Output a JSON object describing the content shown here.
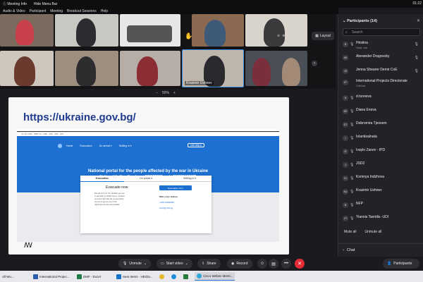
{
  "meeting": {
    "info_label": "Meeting Info",
    "hide_menu_label": "Hide Menu Bar",
    "clock": "01:22"
  },
  "menu": [
    "Audio & Video",
    "Participant",
    "Meeting",
    "Breakout Sessions",
    "Help"
  ],
  "videos": {
    "active_speaker_name": "Krasimir Ushnev",
    "layout_label": "Layout"
  },
  "zoom": {
    "value": "55%",
    "minus": "−",
    "plus": "+"
  },
  "share": {
    "url": "https://ukraine.gov.bg/",
    "site": {
      "topline": "☏ 02 / 905 · 5555   ☏ +380 · 322 · 465 · 075",
      "nav": [
        "Home",
        "Evacuation",
        "On arrival ▾",
        "Settling in ▾"
      ],
      "help_label": "Get help ▸",
      "headline": "National portal for the people affected by the war in Ukraine",
      "hotline": "National Hotline Numbers: 029055555 and +380322465075",
      "tabs": [
        "Evacuation",
        "On arrival ▾",
        "Settling in ▾"
      ],
      "card_title": "Evacuate now",
      "card_para": "We are sorry for the situation you are in and wish to shelter from it. Contact us at the right side tell us everything we can to get you out of the nightmare as soon as possible!",
      "evac_button": "Evacuation form",
      "mfa_label": "MFA crisis hotline:",
      "phone": "+359 29048080",
      "email": "crisis@mfa.bg"
    },
    "footer_mark": "ꟿ"
  },
  "toolbar": {
    "unmute_label": "Unmute",
    "video_label": "Start video",
    "share_label": "Share",
    "record_label": "Record",
    "more_label": "•••",
    "participants_label": "Participants"
  },
  "participants": {
    "title": "Participants (14)",
    "search_placeholder": "Search",
    "list": [
      {
        "name": "Hristina",
        "sub": "Host, me",
        "initials": "H"
      },
      {
        "name": "Alexander Dragovsky",
        "sub": "",
        "initials": "AD"
      },
      {
        "name": "Jenna Shearer Demir CoE",
        "sub": "",
        "initials": "JS"
      },
      {
        "name": "International Projects Directorate",
        "sub": "Cohost",
        "initials": "IP"
      },
      {
        "name": "d.tsoneva",
        "sub": "",
        "initials": "D"
      },
      {
        "name": "Diana Eneva",
        "sub": "",
        "initials": "DE"
      },
      {
        "name": "Dobromira Tjessem",
        "sub": "",
        "initials": "DT"
      },
      {
        "name": "Iolantioalnata",
        "sub": "",
        "initials": "I"
      },
      {
        "name": "Ivaylo Zanev - IPD",
        "sub": "",
        "initials": "IZ"
      },
      {
        "name": "JSD2",
        "sub": "",
        "initials": "J"
      },
      {
        "name": "Komnya Indzhova",
        "sub": "",
        "initials": "KI"
      },
      {
        "name": "Krasimir Ushnev",
        "sub": "",
        "initials": "KU"
      },
      {
        "name": "NFP",
        "sub": "",
        "initials": "N"
      },
      {
        "name": "Yiannis Tavridis -UDI",
        "sub": "",
        "initials": "YT"
      }
    ],
    "mute_all": "Mute all",
    "unmute_all": "Unmute all",
    "chat_label": "Chat"
  },
  "taskbar": [
    {
      "label": "oft Wo..."
    },
    {
      "label": "International Projec..."
    },
    {
      "label": "DMF - Excel"
    },
    {
      "label": "Sent Items - HEGla..."
    },
    {
      "label": "Cisco Webex Meeti..."
    }
  ],
  "colors": {
    "accent": "#1d6fd0",
    "end_call": "#e32b36",
    "site_link": "#1f3a8f"
  }
}
